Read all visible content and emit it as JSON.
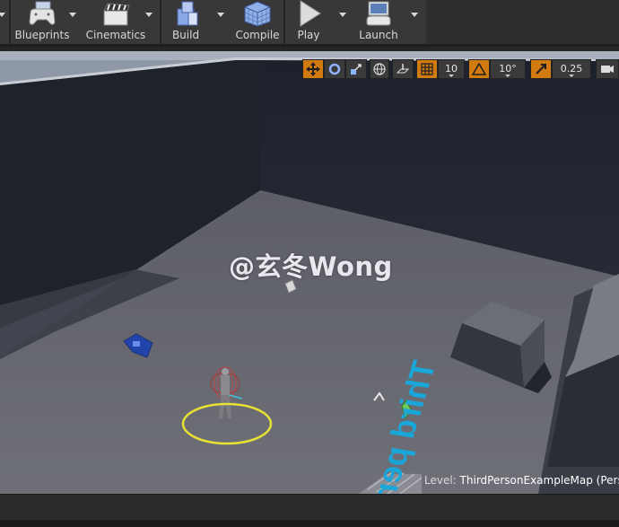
{
  "toolbar": {
    "buttons": [
      {
        "label": "Blueprints",
        "icon": "gamepad-icon"
      },
      {
        "label": "Cinematics",
        "icon": "clapperboard-icon"
      },
      {
        "label": "Build",
        "icon": "cubes-icon"
      },
      {
        "label": "Compile",
        "icon": "rubik-cube-icon"
      },
      {
        "label": "Play",
        "icon": "play-icon"
      },
      {
        "label": "Launch",
        "icon": "launch-device-icon"
      }
    ]
  },
  "viewport_toolbar": {
    "grid_snap_value": "10",
    "rotation_snap_value": "10°",
    "scale_snap_value": "0.25",
    "colors": {
      "active": "#d07a10",
      "inactive": "#3a3a3a"
    }
  },
  "viewport": {
    "level_prefix": "Level:",
    "level_name": "ThirdPersonExampleMap (Pers",
    "floor_text": "Third person",
    "watermark": "@玄冬Wong",
    "colors": {
      "floor_text": "#1aa6d8",
      "selection_ring": "#e8e033"
    }
  }
}
